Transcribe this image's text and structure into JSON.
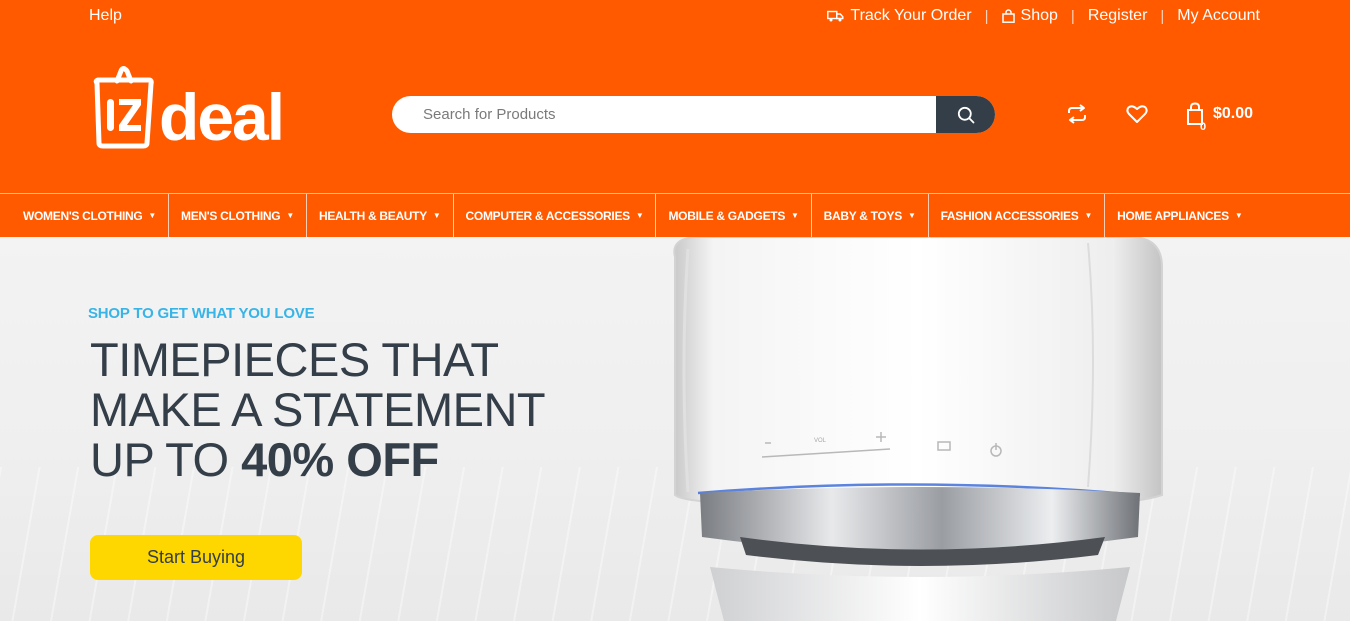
{
  "topbar": {
    "help": "Help",
    "links": [
      "Track Your Order",
      "Shop",
      "Register",
      "My Account"
    ],
    "separator": "|"
  },
  "logo": {
    "text": "deal",
    "bag_letters": "iz"
  },
  "search": {
    "placeholder": "Search for Products",
    "value": ""
  },
  "header_icons": [
    "compare-icon",
    "heart-icon",
    "shopping-bag-icon"
  ],
  "cart": {
    "count": "0",
    "total": "$0.00"
  },
  "nav": {
    "items": [
      "WOMEN'S CLOTHING",
      "MEN'S CLOTHING",
      "HEALTH & BEAUTY",
      "COMPUTER & ACCESSORIES",
      "MOBILE & GADGETS",
      "BABY & TOYS",
      "FASHION ACCESSORIES",
      "HOME APPLIANCES"
    ]
  },
  "hero": {
    "subtitle": "SHOP TO GET WHAT YOU LOVE",
    "title_line1": "TIMEPIECES THAT",
    "title_line2": "MAKE A STATEMENT",
    "title_line3_prefix": "UP TO ",
    "title_line3_bold": "40% OFF",
    "cta": "Start Buying",
    "product_labels": {
      "vol": "VOL",
      "minus": "–",
      "plus": "+"
    }
  },
  "colors": {
    "brand": "#ff5a00",
    "dark": "#333e48",
    "accent_blue": "#38b4e6",
    "cta_yellow": "#fed700"
  }
}
